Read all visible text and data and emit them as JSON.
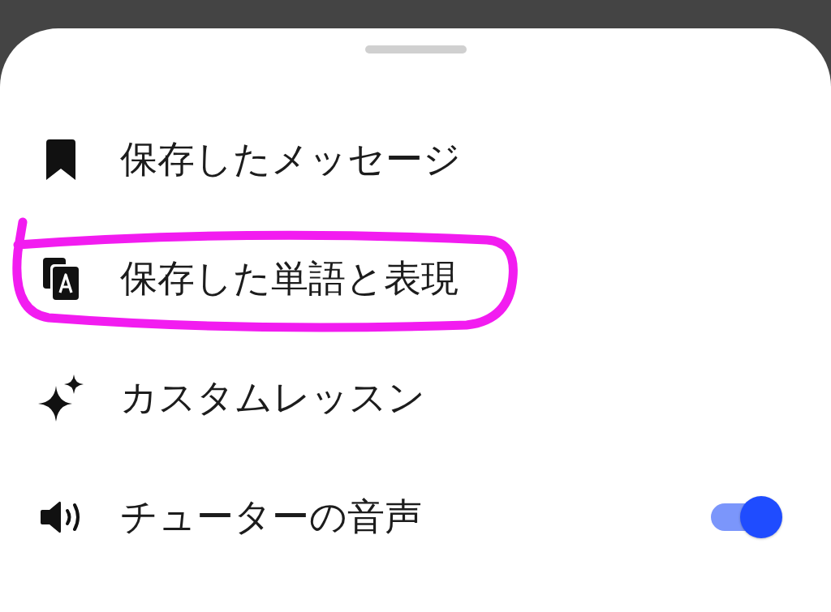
{
  "menu": {
    "items": [
      {
        "kind": "link",
        "label": "保存したメッセージ",
        "circled": false
      },
      {
        "kind": "link",
        "label": "保存した単語と表現",
        "circled": true
      },
      {
        "kind": "link",
        "label": "カスタムレッスン",
        "circled": false
      },
      {
        "kind": "toggle",
        "label": "チューターの音声",
        "circled": false,
        "on": true
      }
    ]
  }
}
